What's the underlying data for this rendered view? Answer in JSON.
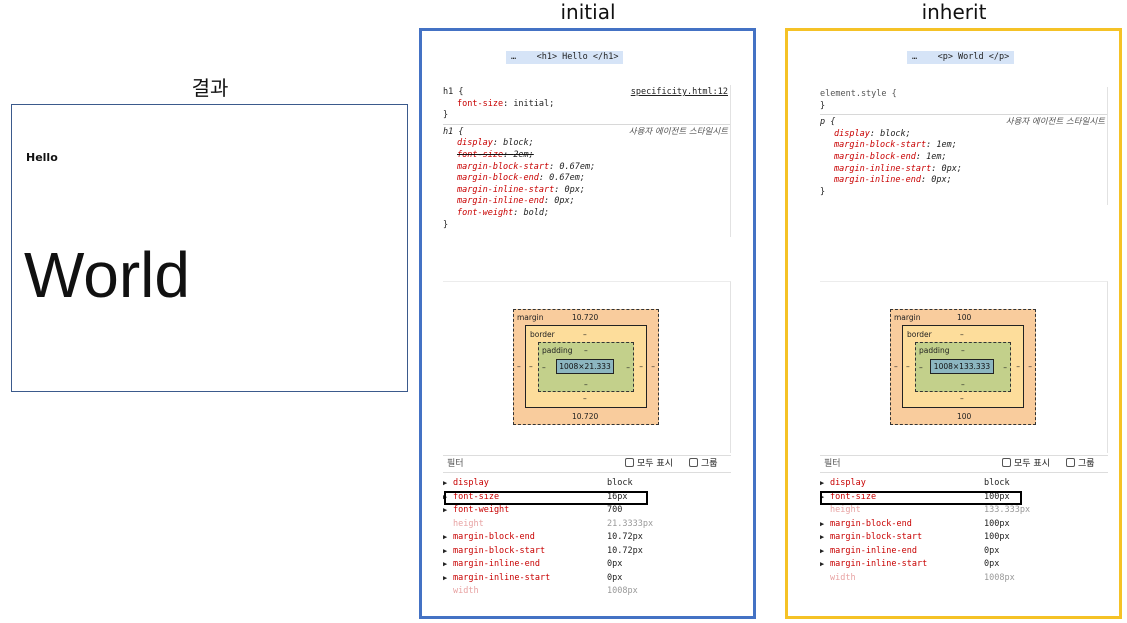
{
  "titles": {
    "result": "결과",
    "initial": "initial",
    "inherit": "inherit"
  },
  "result": {
    "hello": "Hello",
    "world": "World"
  },
  "initial_panel": {
    "breadcrumb": "…    <h1> Hello </h1>",
    "rule1": {
      "selector": "h1 {",
      "source": "specificity.html:12",
      "decls": [
        {
          "p": "font-size",
          "v": "initial;"
        }
      ],
      "close": "}"
    },
    "rule2": {
      "selector": "h1 {",
      "source": "사용자 에이전트 스타일시트",
      "decls": [
        {
          "p": "display",
          "v": "block;"
        },
        {
          "p": "font-size",
          "v": "2em;"
        },
        {
          "p": "margin-block-start",
          "v": "0.67em;"
        },
        {
          "p": "margin-block-end",
          "v": "0.67em;"
        },
        {
          "p": "margin-inline-start",
          "v": "0px;"
        },
        {
          "p": "margin-inline-end",
          "v": "0px;"
        },
        {
          "p": "font-weight",
          "v": "bold;"
        }
      ],
      "close": "}"
    },
    "boxmodel": {
      "margin_label": "margin",
      "margin_top": "10.720",
      "margin_bottom": "10.720",
      "border_label": "border",
      "border_val": "–",
      "padding_label": "padding",
      "padding_val": "–",
      "content": "1008×21.333",
      "dash": "–"
    },
    "filter": {
      "placeholder": "필터",
      "show_all": "모두 표시",
      "group": "그룹"
    },
    "computed": [
      {
        "p": "display",
        "v": "block"
      },
      {
        "p": "font-size",
        "v": "16px"
      },
      {
        "p": "font-weight",
        "v": "700"
      },
      {
        "p": "height",
        "v": "21.3333px"
      },
      {
        "p": "margin-block-end",
        "v": "10.72px"
      },
      {
        "p": "margin-block-start",
        "v": "10.72px"
      },
      {
        "p": "margin-inline-end",
        "v": "0px"
      },
      {
        "p": "margin-inline-start",
        "v": "0px"
      },
      {
        "p": "width",
        "v": "1008px"
      }
    ]
  },
  "inherit_panel": {
    "breadcrumb": "…    <p> World </p>",
    "rule1": {
      "selector": "element.style {",
      "close": "}"
    },
    "rule2": {
      "selector": "p {",
      "source": "사용자 에이전트 스타일시트",
      "decls": [
        {
          "p": "display",
          "v": "block;"
        },
        {
          "p": "margin-block-start",
          "v": "1em;"
        },
        {
          "p": "margin-block-end",
          "v": "1em;"
        },
        {
          "p": "margin-inline-start",
          "v": "0px;"
        },
        {
          "p": "margin-inline-end",
          "v": "0px;"
        }
      ],
      "close": "}"
    },
    "boxmodel": {
      "margin_label": "margin",
      "margin_top": "100",
      "margin_bottom": "100",
      "border_label": "border",
      "border_val": "–",
      "padding_label": "padding",
      "padding_val": "–",
      "content": "1008×133.333",
      "dash": "–"
    },
    "filter": {
      "placeholder": "필터",
      "show_all": "모두 표시",
      "group": "그룹"
    },
    "computed": [
      {
        "p": "display",
        "v": "block"
      },
      {
        "p": "font-size",
        "v": "100px"
      },
      {
        "p": "height",
        "v": "133.333px"
      },
      {
        "p": "margin-block-end",
        "v": "100px"
      },
      {
        "p": "margin-block-start",
        "v": "100px"
      },
      {
        "p": "margin-inline-end",
        "v": "0px"
      },
      {
        "p": "margin-inline-start",
        "v": "0px"
      },
      {
        "p": "width",
        "v": "1008px"
      }
    ]
  },
  "colors": {
    "initial_border": "#4472c4",
    "inherit_border": "#f5c226",
    "highlight": "#000000"
  }
}
